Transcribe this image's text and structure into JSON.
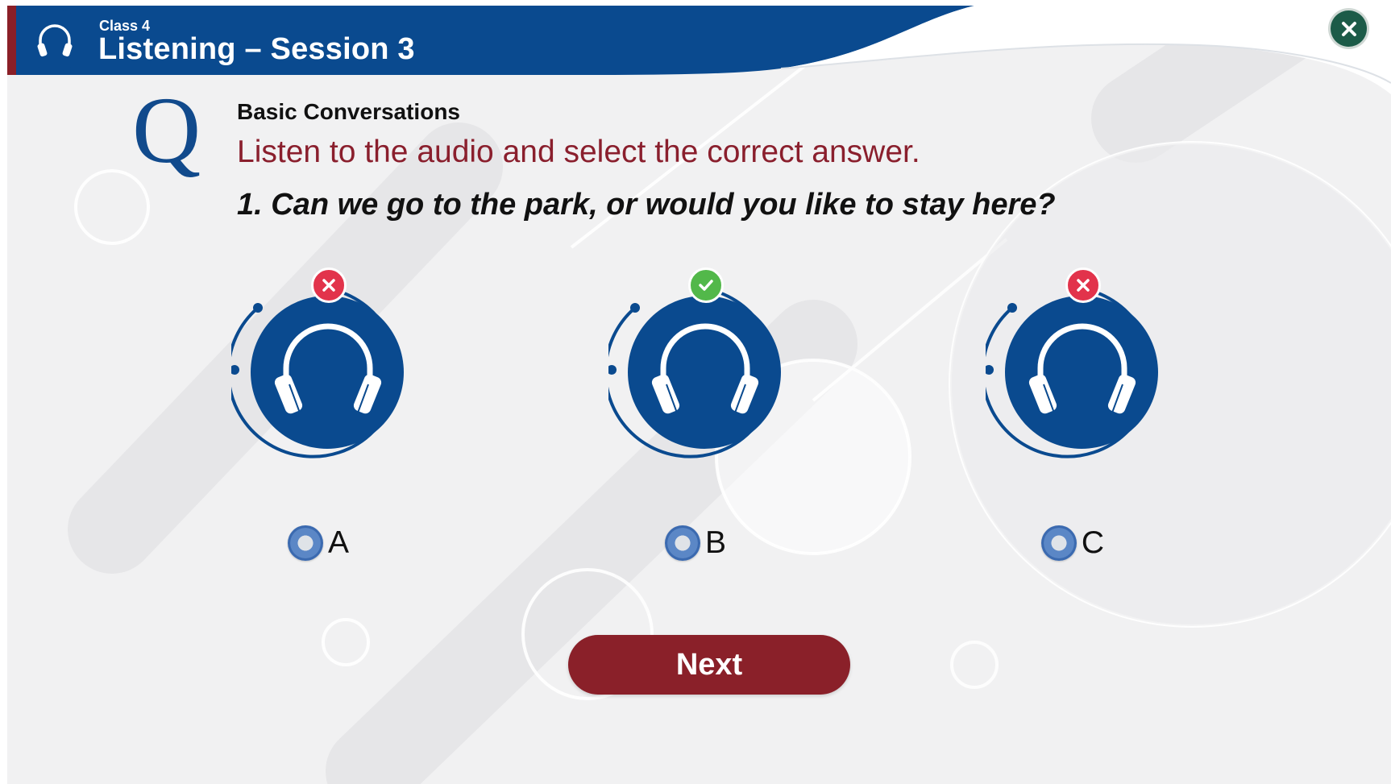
{
  "header": {
    "class_label": "Class 4",
    "title": "Listening – Session 3",
    "icon": "headphones-icon"
  },
  "close_button": {
    "icon": "close-icon"
  },
  "question": {
    "marker": "Q",
    "category": "Basic Conversations",
    "instruction": "Listen to the audio and select the correct answer.",
    "text": "1. Can we go to the park, or would you like to stay here?"
  },
  "options": [
    {
      "label": "A",
      "status": "incorrect",
      "status_icon": "cross-icon"
    },
    {
      "label": "B",
      "status": "correct",
      "status_icon": "check-icon"
    },
    {
      "label": "C",
      "status": "incorrect",
      "status_icon": "cross-icon"
    }
  ],
  "next_button": {
    "label": "Next"
  },
  "colors": {
    "header_blue": "#0a4a8f",
    "accent_red": "#8a1f2d",
    "correct_green": "#52b84a",
    "incorrect_red": "#e2334b",
    "close_green": "#1c5b48"
  }
}
